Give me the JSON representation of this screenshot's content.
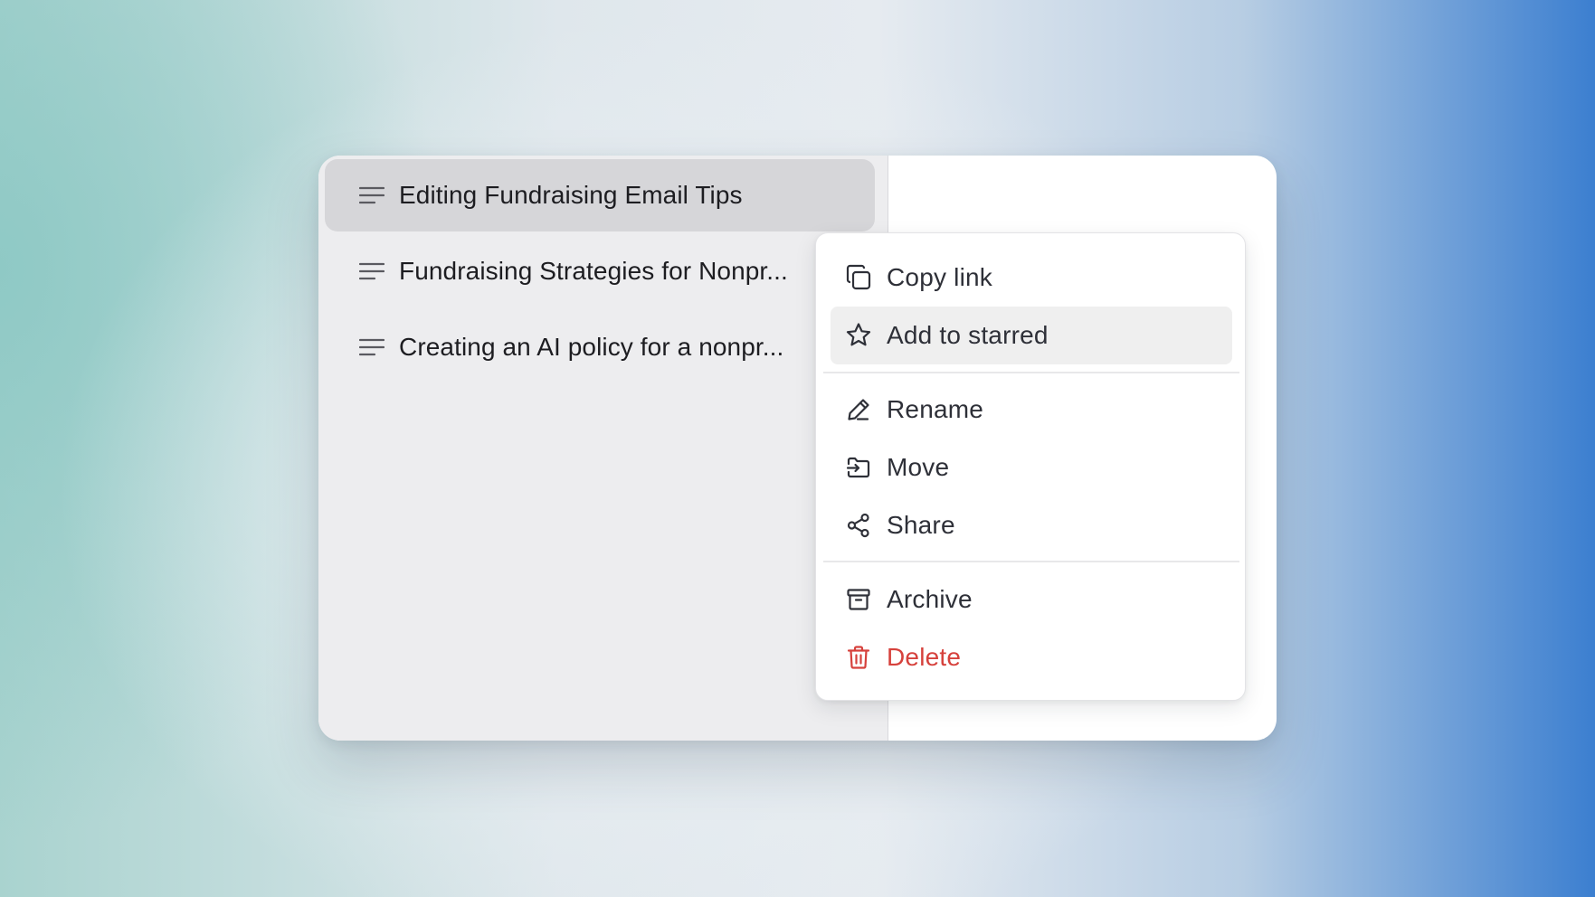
{
  "sidebar": {
    "items": [
      {
        "label": "Editing Fundraising Email Tips",
        "icon": "text-lines-icon",
        "active": true
      },
      {
        "label": "Fundraising Strategies for Nonpr...",
        "icon": "text-lines-icon",
        "active": false
      },
      {
        "label": "Creating an AI policy for a nonpr...",
        "icon": "text-lines-icon",
        "active": false
      }
    ]
  },
  "context_menu": {
    "items": [
      {
        "label": "Copy link",
        "icon": "copy-icon"
      },
      {
        "label": "Add to starred",
        "icon": "star-icon"
      },
      {
        "label": "Rename",
        "icon": "pencil-icon"
      },
      {
        "label": "Move",
        "icon": "move-icon"
      },
      {
        "label": "Share",
        "icon": "share-icon"
      },
      {
        "label": "Archive",
        "icon": "archive-icon"
      },
      {
        "label": "Delete",
        "icon": "trash-icon"
      }
    ]
  },
  "colors": {
    "danger": "#d6413c",
    "active_item_bg": "#d6d6d9",
    "hover_item_bg": "#efefef",
    "sidebar_bg": "#ededef"
  }
}
